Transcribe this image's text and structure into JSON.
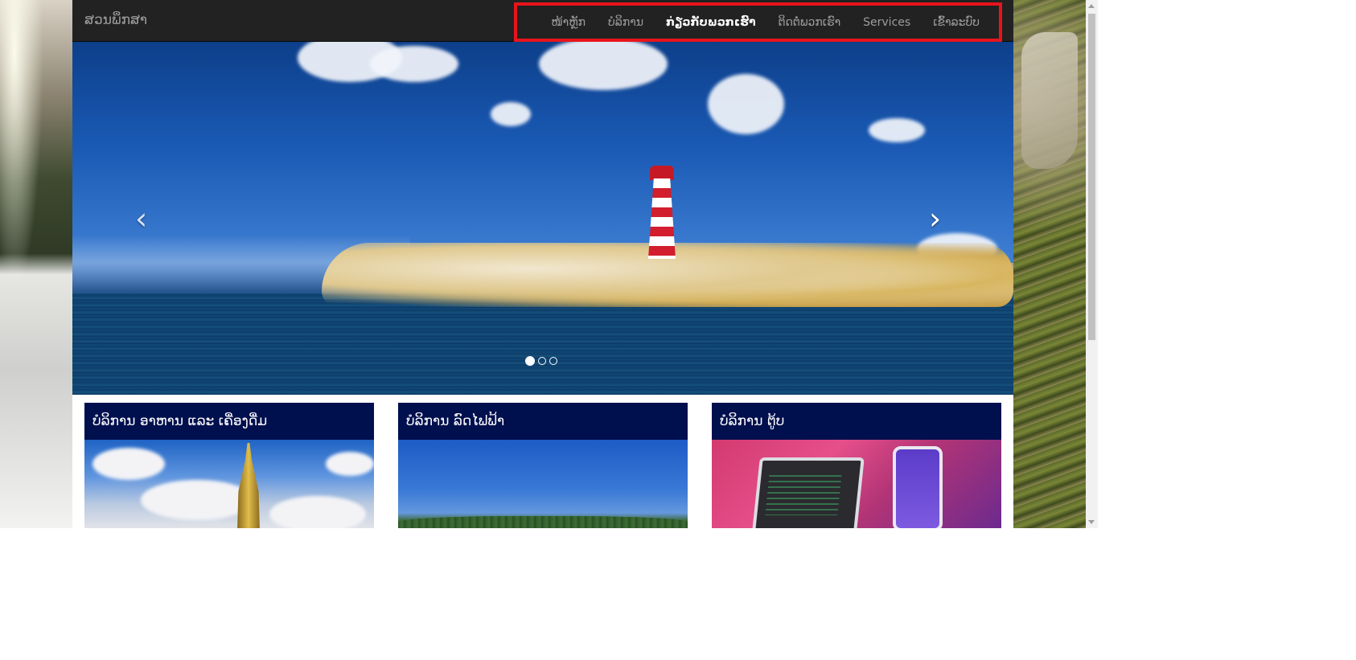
{
  "navbar": {
    "brand": "ສວນພຶກສາ",
    "items": [
      {
        "label": "ໜ້າຫຼັກ",
        "active": false
      },
      {
        "label": "ບໍລິການ",
        "active": false
      },
      {
        "label": "ກ່ຽວກັບພວກເຮົາ",
        "active": true
      },
      {
        "label": "ຕິດຕໍ່ພວກເຮົາ",
        "active": false
      },
      {
        "label": "Services",
        "active": false
      },
      {
        "label": "ເຂົ້າລະບົບ",
        "active": false
      }
    ]
  },
  "carousel": {
    "prev_icon": "‹",
    "next_icon": "›",
    "slide_count": 3,
    "active_index": 0
  },
  "cards": [
    {
      "title": "ບໍລິການ ອາຫານ ແລະ ເຄື່ອງດື່ມ"
    },
    {
      "title": "ບໍລິການ ລົດໄຟຟ້າ"
    },
    {
      "title": "ບໍລິການ ຕູ້ບ"
    }
  ],
  "colors": {
    "navbar_bg": "#222222",
    "card_header_bg": "#000f4d",
    "highlight_border": "#e8141b"
  }
}
